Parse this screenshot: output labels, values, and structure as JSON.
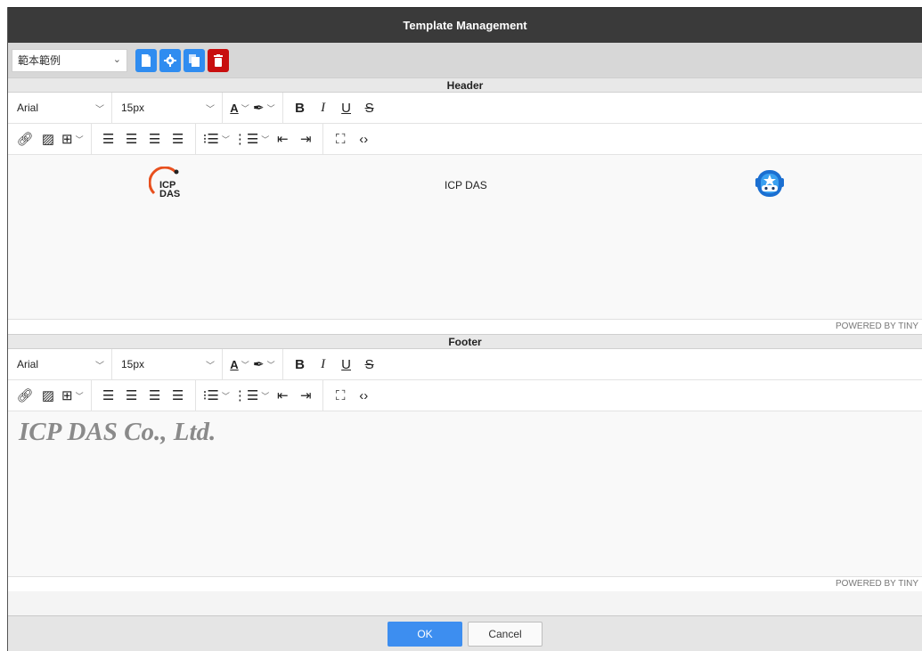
{
  "dialog": {
    "title": "Template Management"
  },
  "template_toolbar": {
    "selected_template": "範本範例",
    "buttons": [
      {
        "name": "new-template",
        "icon": "file-icon",
        "color": "#2f8cf0"
      },
      {
        "name": "settings",
        "icon": "gear-icon",
        "color": "#2f8cf0"
      },
      {
        "name": "copy-template",
        "icon": "copy-icon",
        "color": "#2f8cf0"
      },
      {
        "name": "delete-template",
        "icon": "trash-icon",
        "color": "#c80f0f"
      }
    ]
  },
  "header_editor": {
    "label": "Header",
    "font_family": "Arial",
    "font_size": "15px",
    "content_text": "ICP DAS",
    "logo_text_top": "ICP",
    "logo_text_bottom": "DAS",
    "status": "POWERED BY TINY"
  },
  "footer_editor": {
    "label": "Footer",
    "font_family": "Arial",
    "font_size": "15px",
    "content_text": "ICP DAS Co., Ltd.",
    "status": "POWERED BY TINY"
  },
  "toolbar_icons": {
    "bold": "B",
    "italic": "I",
    "underline": "U",
    "strike": "S",
    "text_color": "A"
  },
  "actions": {
    "ok": "OK",
    "cancel": "Cancel"
  },
  "colors": {
    "accent": "#2f8cf0",
    "danger": "#c80f0f",
    "ok_button": "#3d8ef0",
    "logo_orange": "#e8501e"
  }
}
